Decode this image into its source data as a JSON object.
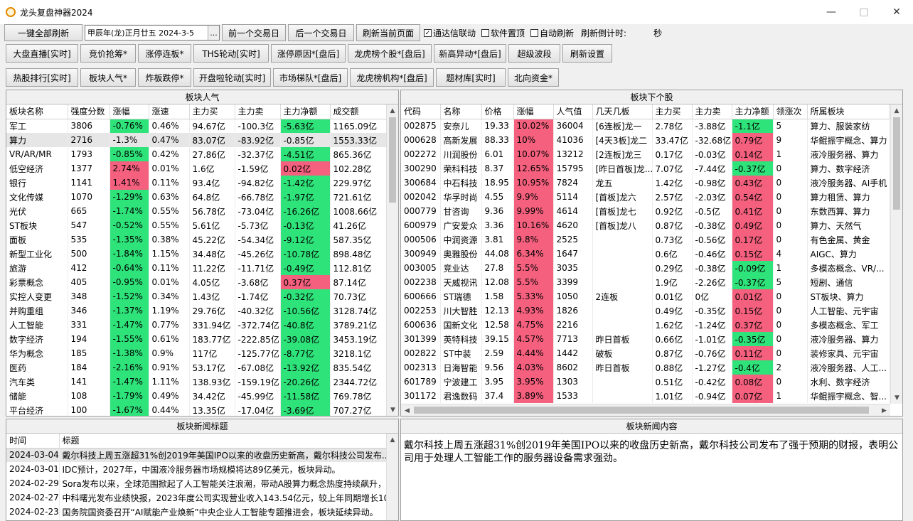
{
  "window": {
    "title": "龙头复盘神器2024",
    "minimize": "—",
    "maximize": "□",
    "close": "✕"
  },
  "toolbar1": {
    "refresh_all": "一键全部刷新",
    "date_value": "甲辰年(龙)正月廿五 2024-3-5",
    "date_picker": "...",
    "prev_day": "前一个交易日",
    "next_day": "后一个交易日",
    "refresh_page": "刷新当前页面",
    "checks": [
      {
        "label": "通达信联动",
        "checked": true
      },
      {
        "label": "软件置顶",
        "checked": false
      },
      {
        "label": "自动刷新",
        "checked": false
      }
    ],
    "countdown_label": "刷新倒计时:",
    "countdown_unit": "秒"
  },
  "toolbar2": [
    "大盘直播[实时]",
    "竞价抢筹*",
    "涨停连板*",
    "THS轮动[实时]",
    "涨停原因*[盘后]",
    "龙虎榜个股*[盘后]",
    "新高异动*[盘后]",
    "超级波段",
    "刷新设置"
  ],
  "toolbar3": [
    "热股排行[实时]",
    "板块人气*",
    "炸板跌停*",
    "开盘啦轮动[实时]",
    "市场梯队*[盘后]",
    "龙虎榜机构*[盘后]",
    "题材库[实时]",
    "北向资金*"
  ],
  "sector_panel": {
    "title": "板块人气",
    "columns": [
      "板块名称",
      "强度分数",
      "涨幅",
      "涨速",
      "主力买",
      "主力卖",
      "主力净额",
      "成交额"
    ],
    "rows": [
      [
        "军工",
        "3806",
        "-0.76%",
        "0.46%",
        "94.67亿",
        "-100.3亿",
        "-5.63亿",
        "1165.09亿"
      ],
      [
        "算力",
        "2716",
        "-1.3%",
        "0.47%",
        "83.07亿",
        "-83.92亿",
        "-0.85亿",
        "1553.33亿"
      ],
      [
        "VR/AR/MR",
        "1793",
        "-0.85%",
        "0.42%",
        "27.86亿",
        "-32.37亿",
        "-4.51亿",
        "865.36亿"
      ],
      [
        "低空经济",
        "1377",
        "2.74%",
        "0.01%",
        "1.6亿",
        "-1.59亿",
        "0.02亿",
        "102.28亿"
      ],
      [
        "银行",
        "1141",
        "1.41%",
        "0.11%",
        "93.4亿",
        "-94.82亿",
        "-1.42亿",
        "229.97亿"
      ],
      [
        "文化传媒",
        "1070",
        "-1.29%",
        "0.63%",
        "64.8亿",
        "-66.78亿",
        "-1.97亿",
        "721.61亿"
      ],
      [
        "光伏",
        "665",
        "-1.74%",
        "0.55%",
        "56.78亿",
        "-73.04亿",
        "-16.26亿",
        "1008.66亿"
      ],
      [
        "ST板块",
        "547",
        "-0.52%",
        "0.55%",
        "5.61亿",
        "-5.73亿",
        "-0.13亿",
        "41.26亿"
      ],
      [
        "面板",
        "535",
        "-1.35%",
        "0.38%",
        "45.22亿",
        "-54.34亿",
        "-9.12亿",
        "587.35亿"
      ],
      [
        "新型工业化",
        "500",
        "-1.84%",
        "1.15%",
        "34.48亿",
        "-45.26亿",
        "-10.78亿",
        "898.48亿"
      ],
      [
        "旅游",
        "412",
        "-0.64%",
        "0.11%",
        "11.22亿",
        "-11.71亿",
        "-0.49亿",
        "112.81亿"
      ],
      [
        "彩票概念",
        "405",
        "-0.95%",
        "0.01%",
        "4.05亿",
        "-3.68亿",
        "0.37亿",
        "87.14亿"
      ],
      [
        "实控人变更",
        "348",
        "-1.52%",
        "0.34%",
        "1.43亿",
        "-1.74亿",
        "-0.32亿",
        "70.73亿"
      ],
      [
        "并购重组",
        "346",
        "-1.37%",
        "1.19%",
        "29.76亿",
        "-40.32亿",
        "-10.56亿",
        "3128.74亿"
      ],
      [
        "人工智能",
        "331",
        "-1.47%",
        "0.77%",
        "331.94亿",
        "-372.74亿",
        "-40.8亿",
        "3789.21亿"
      ],
      [
        "数字经济",
        "194",
        "-1.55%",
        "0.61%",
        "183.77亿",
        "-222.85亿",
        "-39.08亿",
        "3453.19亿"
      ],
      [
        "华为概念",
        "185",
        "-1.38%",
        "0.9%",
        "117亿",
        "-125.77亿",
        "-8.77亿",
        "3218.1亿"
      ],
      [
        "医药",
        "184",
        "-2.16%",
        "0.91%",
        "53.17亿",
        "-67.08亿",
        "-13.92亿",
        "835.54亿"
      ],
      [
        "汽车类",
        "141",
        "-1.47%",
        "1.11%",
        "138.93亿",
        "-159.19亿",
        "-20.26亿",
        "2344.72亿"
      ],
      [
        "储能",
        "108",
        "-1.79%",
        "0.49%",
        "34.42亿",
        "-45.99亿",
        "-11.58亿",
        "769.78亿"
      ],
      [
        "平台经济",
        "100",
        "-1.67%",
        "0.44%",
        "13.35亿",
        "-17.04亿",
        "-3.69亿",
        "707.27亿"
      ]
    ]
  },
  "stock_panel": {
    "title": "板块下个股",
    "columns": [
      "代码",
      "名称",
      "价格",
      "涨幅",
      "人气值",
      "几天几板",
      "主力买",
      "主力卖",
      "主力净额",
      "领涨次",
      "所属板块"
    ],
    "rows": [
      [
        "002875",
        "安奈儿",
        "19.33",
        "10.02%",
        "36004",
        "[6连板]龙一",
        "2.78亿",
        "-3.88亿",
        "-1.1亿",
        "5",
        "算力、服装家纺"
      ],
      [
        "000628",
        "高新发展",
        "88.33",
        "10%",
        "41036",
        "[4天3板]龙二",
        "33.47亿",
        "-32.68亿",
        "0.79亿",
        "9",
        "华鲲振宇概念、算力"
      ],
      [
        "002272",
        "川润股份",
        "6.01",
        "10.07%",
        "13212",
        "[2连板]龙三",
        "0.17亿",
        "-0.03亿",
        "0.14亿",
        "1",
        "液冷服务器、算力"
      ],
      [
        "300290",
        "荣科科技",
        "8.37",
        "12.65%",
        "15795",
        "[昨日首板]龙...",
        "7.07亿",
        "-7.44亿",
        "-0.37亿",
        "0",
        "算力、数字经济"
      ],
      [
        "300684",
        "中石科技",
        "18.95",
        "10.95%",
        "7824",
        "龙五",
        "1.42亿",
        "-0.98亿",
        "0.43亿",
        "0",
        "液冷服务器、AI手机"
      ],
      [
        "002042",
        "华孚时尚",
        "4.55",
        "9.9%",
        "5114",
        "[首板]龙六",
        "2.57亿",
        "-2.03亿",
        "0.54亿",
        "0",
        "算力租赁、算力"
      ],
      [
        "000779",
        "甘咨询",
        "9.36",
        "9.99%",
        "4614",
        "[首板]龙七",
        "0.92亿",
        "-0.5亿",
        "0.41亿",
        "0",
        "东数西算、算力"
      ],
      [
        "600979",
        "广安爱众",
        "3.36",
        "10.16%",
        "4620",
        "[首板]龙八",
        "0.87亿",
        "-0.38亿",
        "0.49亿",
        "0",
        "算力、天然气"
      ],
      [
        "000506",
        "中润资源",
        "3.81",
        "9.8%",
        "2525",
        "",
        "0.73亿",
        "-0.56亿",
        "0.17亿",
        "0",
        "有色金属、黄金"
      ],
      [
        "300949",
        "奥雅股份",
        "44.08",
        "6.34%",
        "1647",
        "",
        "0.6亿",
        "-0.46亿",
        "0.15亿",
        "4",
        "AIGC、算力"
      ],
      [
        "003005",
        "竞业达",
        "27.8",
        "5.5%",
        "3035",
        "",
        "0.29亿",
        "-0.38亿",
        "-0.09亿",
        "1",
        "多模态概念、VR/..."
      ],
      [
        "002238",
        "天威视讯",
        "12.08",
        "5.5%",
        "3399",
        "",
        "1.9亿",
        "-2.26亿",
        "-0.37亿",
        "5",
        "短剧、通信"
      ],
      [
        "600666",
        "ST瑞德",
        "1.58",
        "5.33%",
        "1050",
        "2连板",
        "0.01亿",
        "0亿",
        "0.01亿",
        "0",
        "ST板块、算力"
      ],
      [
        "002253",
        "川大智胜",
        "12.13",
        "4.93%",
        "1826",
        "",
        "0.49亿",
        "-0.35亿",
        "0.15亿",
        "0",
        "人工智能、元宇宙"
      ],
      [
        "600636",
        "国新文化",
        "12.58",
        "4.75%",
        "2216",
        "",
        "1.62亿",
        "-1.24亿",
        "0.37亿",
        "0",
        "多模态概念、军工"
      ],
      [
        "301399",
        "英特科技",
        "39.15",
        "4.57%",
        "7713",
        "昨日首板",
        "0.66亿",
        "-1.01亿",
        "-0.35亿",
        "0",
        "液冷服务器、算力"
      ],
      [
        "002822",
        "ST中装",
        "2.59",
        "4.44%",
        "1442",
        "破板",
        "0.87亿",
        "-0.76亿",
        "0.11亿",
        "0",
        "装修家具、元宇宙"
      ],
      [
        "002313",
        "日海智能",
        "9.56",
        "4.03%",
        "8602",
        "昨日首板",
        "0.88亿",
        "-1.27亿",
        "-0.4亿",
        "2",
        "液冷服务器、人工..."
      ],
      [
        "601789",
        "宁波建工",
        "3.95",
        "3.95%",
        "1303",
        "",
        "0.51亿",
        "-0.42亿",
        "0.08亿",
        "0",
        "水利、数字经济"
      ],
      [
        "301172",
        "君逸数码",
        "37.4",
        "3.89%",
        "1533",
        "",
        "1.01亿",
        "-0.94亿",
        "0.07亿",
        "1",
        "华鲲振宇概念、智..."
      ]
    ]
  },
  "news_list": {
    "title": "板块新闻标题",
    "columns": [
      "时间",
      "标题"
    ],
    "rows": [
      [
        "2024-03-04",
        "戴尔科技上周五涨超31%创2019年美国IPO以来的收盘历史新高，戴尔科技公司发布..."
      ],
      [
        "2024-03-01",
        "IDC预计，2027年，中国液冷服务器市场规模将达89亿美元，板块异动。"
      ],
      [
        "2024-02-29",
        "Sora发布以来，全球范围掀起了人工智能关注浪潮，带动A股算力概念热度持续飙升，..."
      ],
      [
        "2024-02-27",
        "中科曙光发布业绩快报，2023年度公司实现营业收入143.54亿元，较上年同期增长10...."
      ],
      [
        "2024-02-23",
        "国务院国资委召开“AI赋能产业焕新”中央企业人工智能专题推进会，板块延续异动。"
      ]
    ]
  },
  "news_content": {
    "title": "板块新闻内容",
    "text": "戴尔科技上周五涨超31%创2019年美国IPO以来的收盘历史新高，戴尔科技公司发布了强于预期的财报，表明公司用于处理人工智能工作的服务器设备需求强劲。"
  },
  "colors": {
    "up": "#f5607e",
    "down": "#2ee37a"
  }
}
